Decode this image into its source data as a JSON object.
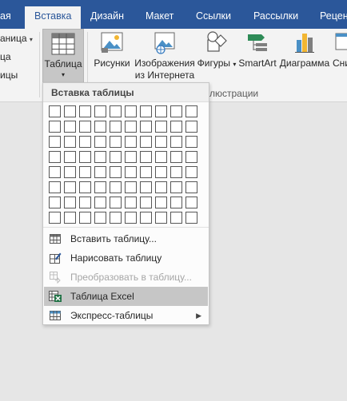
{
  "tabs": [
    {
      "label": "ая",
      "active": false
    },
    {
      "label": "Вставка",
      "active": true
    },
    {
      "label": "Дизайн",
      "active": false
    },
    {
      "label": "Макет",
      "active": false
    },
    {
      "label": "Ссылки",
      "active": false
    },
    {
      "label": "Рассылки",
      "active": false
    },
    {
      "label": "Реценз",
      "active": false
    }
  ],
  "left_group": {
    "item1": "аница",
    "item2": "ца",
    "item3": "ицы"
  },
  "ribbon_buttons": {
    "table": "Таблица",
    "pictures": "Рисунки",
    "online_pictures_line1": "Изображения",
    "online_pictures_line2": "из Интернета",
    "shapes": "Фигуры",
    "smartart": "SmartArt",
    "chart": "Диаграмма",
    "screenshot": "Сни"
  },
  "group_label_illustrations": "ллюстрации",
  "menu": {
    "header": "Вставка таблицы",
    "grid_columns": 10,
    "grid_rows": 8,
    "items": [
      {
        "label": "Вставить таблицу...",
        "enabled": true,
        "icon": "table-insert-icon"
      },
      {
        "label": "Нарисовать таблицу",
        "enabled": true,
        "icon": "draw-table-icon"
      },
      {
        "label": "Преобразовать в таблицу...",
        "enabled": false,
        "icon": "convert-table-icon"
      },
      {
        "label": "Таблица Excel",
        "enabled": true,
        "icon": "excel-table-icon",
        "highlighted": true
      },
      {
        "label": "Экспресс-таблицы",
        "enabled": true,
        "icon": "quick-tables-icon",
        "submenu": true
      }
    ]
  },
  "colors": {
    "accent": "#2b579a",
    "ribbon_bg": "#f3f3f3",
    "excel_green": "#217346",
    "highlight": "#c6c6c6"
  }
}
